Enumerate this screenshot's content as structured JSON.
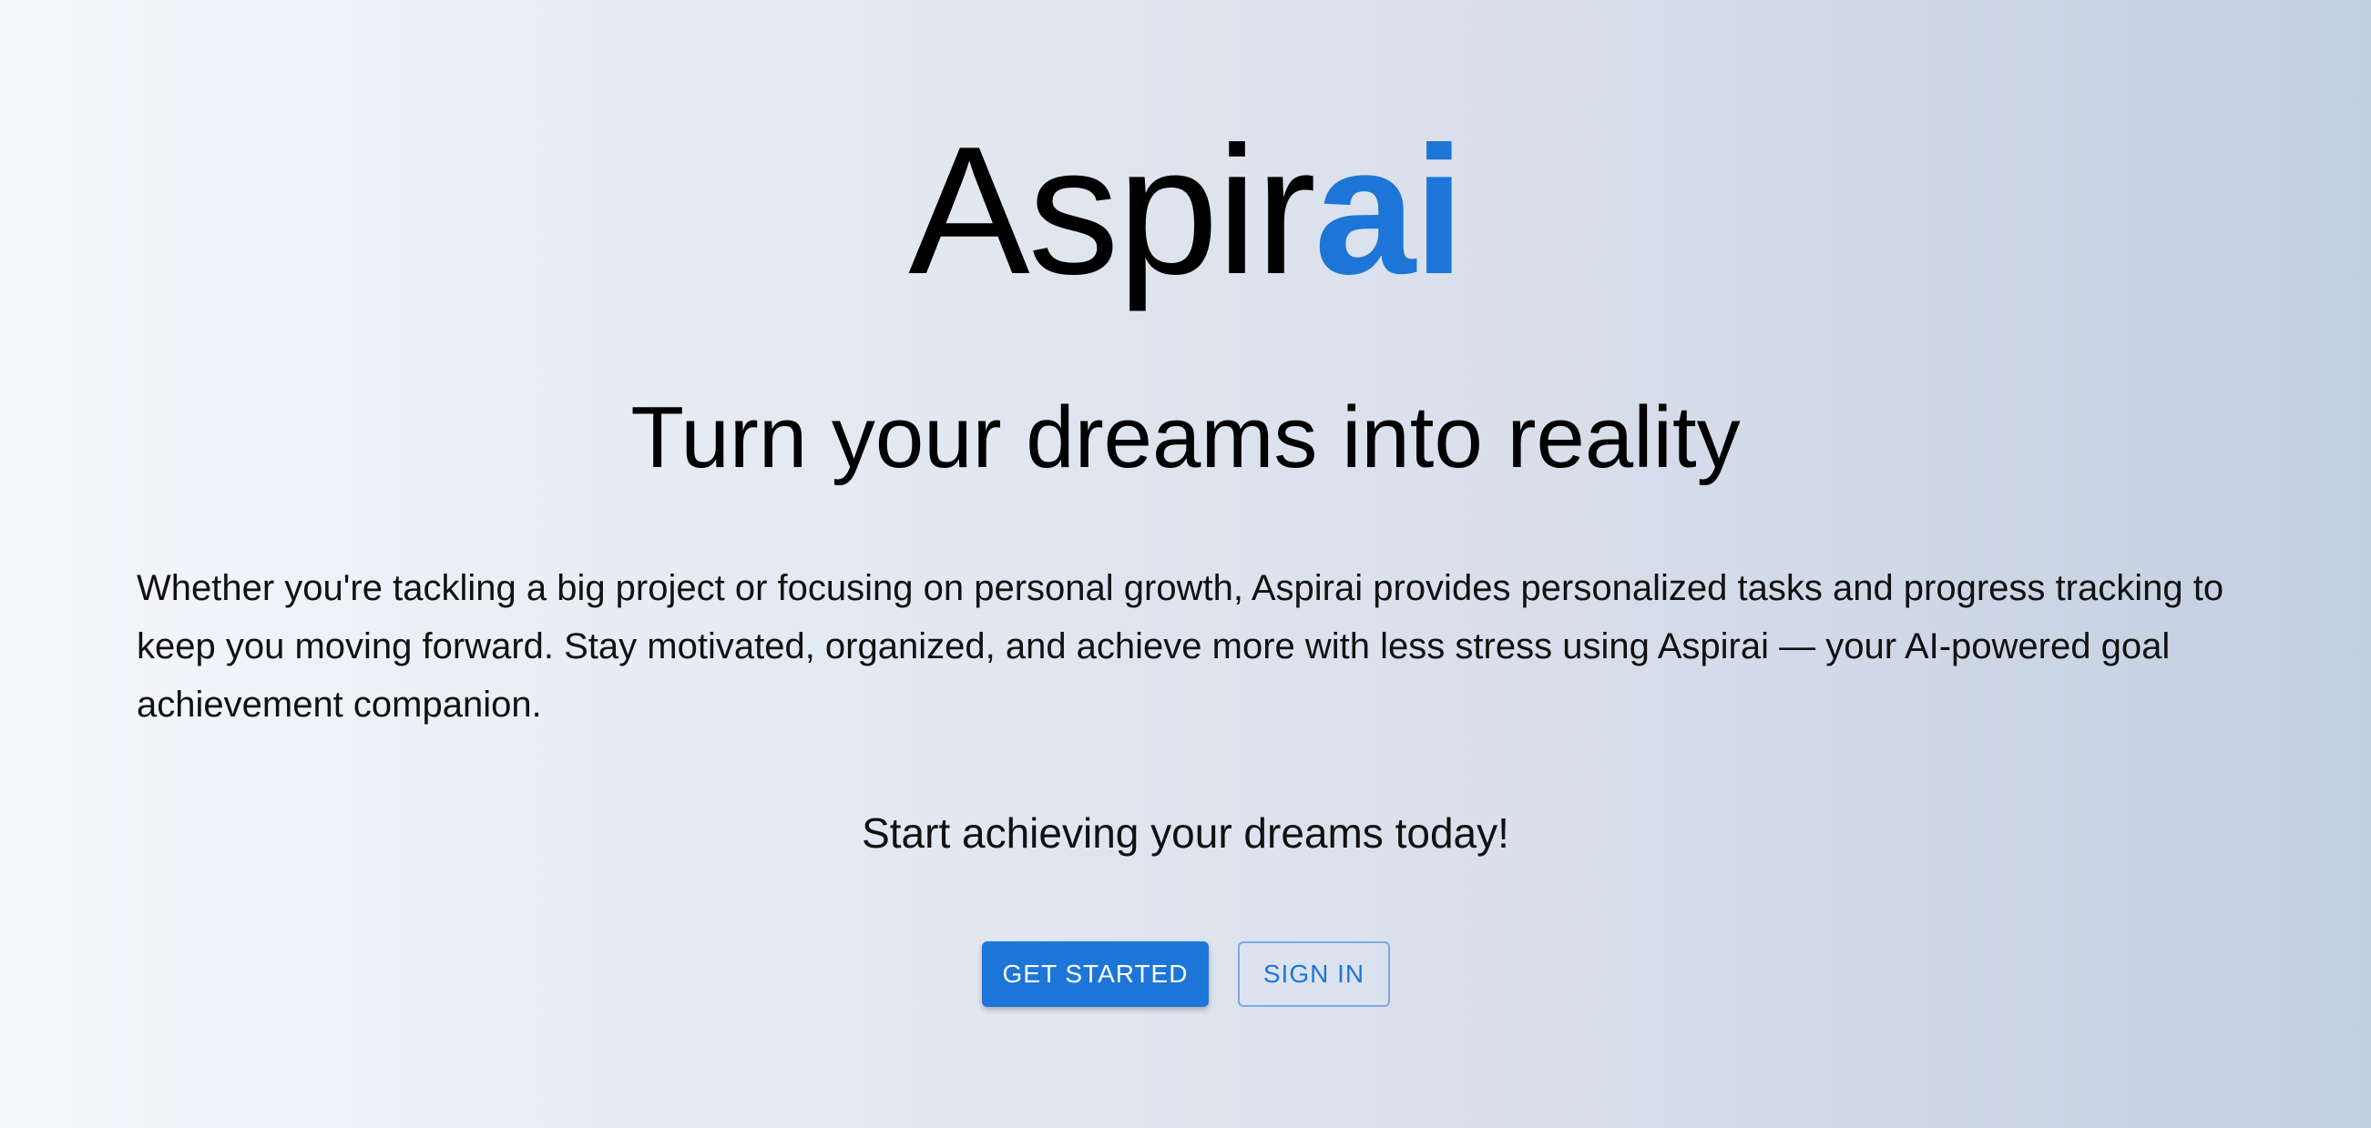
{
  "brand": {
    "logo_prefix": "Aspir",
    "logo_accent": "ai",
    "accent_color": "#1d75d8"
  },
  "hero": {
    "headline": "Turn your dreams into reality",
    "description": "Whether you're tackling a big project or focusing on personal growth, Aspirai provides personalized tasks and progress tracking to keep you moving forward. Stay motivated, organized, and achieve more with less stress using Aspirai — your AI-powered goal achievement companion.",
    "cta_text": "Start achieving your dreams today!"
  },
  "actions": {
    "get_started_label": "GET STARTED",
    "sign_in_label": "SIGN IN"
  }
}
